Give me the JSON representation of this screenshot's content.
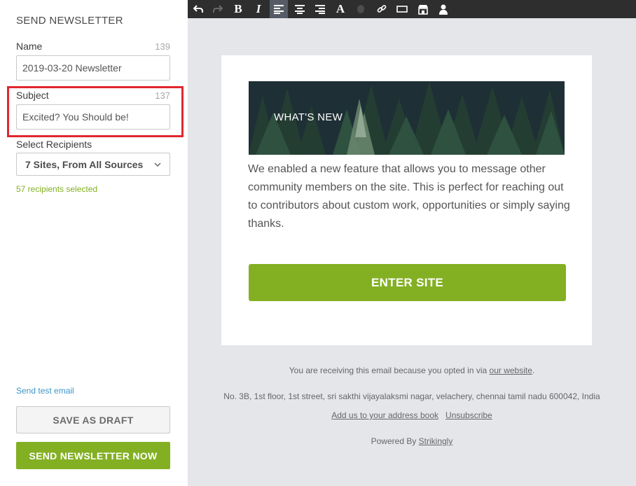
{
  "sidebar": {
    "title": "SEND NEWSLETTER",
    "name_label": "Name",
    "name_count": "139",
    "name_value": "2019-03-20 Newsletter",
    "subject_label": "Subject",
    "subject_count": "137",
    "subject_value": "Excited? You Should be!",
    "recipients_label": "Select Recipients",
    "recipients_value": "7 Sites, From All Sources",
    "recipients_selected": "57 recipients selected",
    "send_test": "Send test email",
    "save_draft": "SAVE AS DRAFT",
    "send_now": "SEND NEWSLETTER NOW"
  },
  "toolbar": {
    "icons": [
      "undo-icon",
      "redo-icon",
      "bold-icon",
      "italic-icon",
      "align-left-icon",
      "align-center-icon",
      "align-right-icon",
      "font-icon",
      "color-icon",
      "link-icon",
      "button-icon",
      "store-icon",
      "user-icon"
    ],
    "active": "align-left-icon"
  },
  "email": {
    "banner_text": "WHAT'S NEW",
    "body": "We enabled a new feature that allows you to message other community members on the site. This is perfect for reaching out to contributors about custom work, opportunities or simply saying thanks.",
    "cta": "ENTER SITE"
  },
  "footer": {
    "notice_prefix": "You are receiving this email because you opted in via",
    "notice_link": "our website",
    "notice_suffix": ".",
    "address": "No. 3B, 1st floor, 1st street, sri sakthi vijayalaksmi nagar, velachery, chennai tamil nadu 600042, India",
    "address_book": "Add us to your address book",
    "unsubscribe": "Unsubscribe",
    "powered_prefix": "Powered By",
    "powered_link": "Strikingly"
  },
  "colors": {
    "accent_green": "#83b023",
    "highlight_red": "#e0282e",
    "link_blue": "#3e95c9",
    "toolbar_bg": "#2e2e2e",
    "editor_bg": "#e4e6ea"
  }
}
